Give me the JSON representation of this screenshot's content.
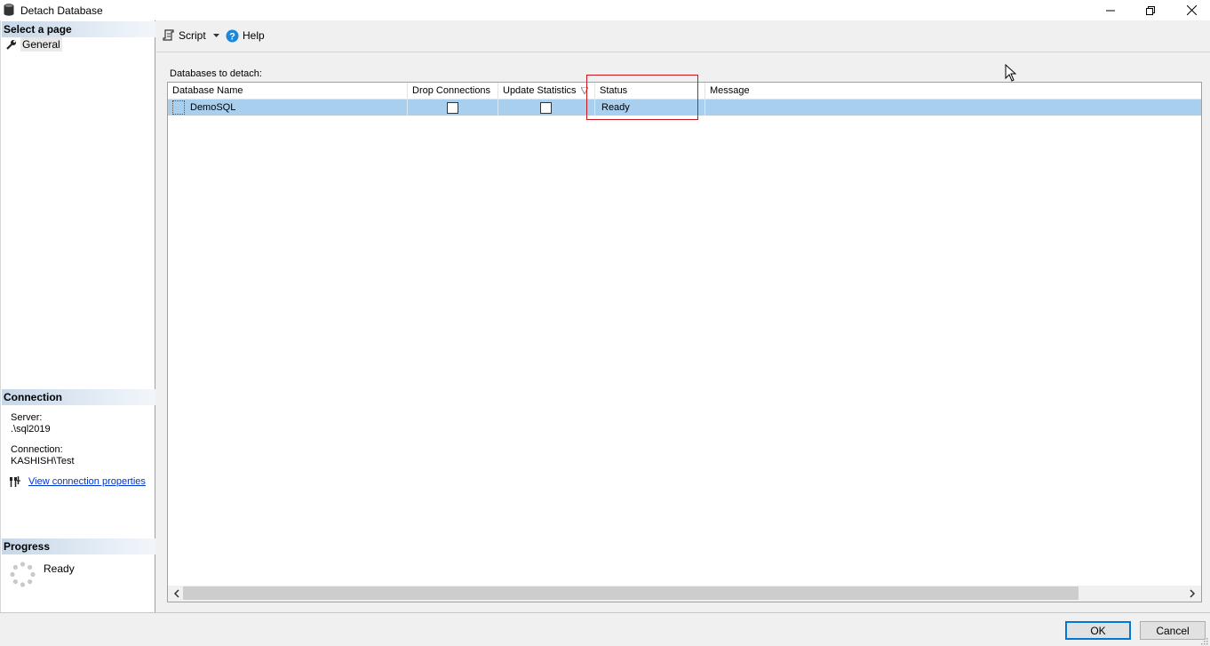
{
  "window": {
    "title": "Detach Database",
    "minimize_label": "minimize",
    "restore_label": "restore",
    "close_label": "close"
  },
  "left_panel": {
    "select_page_header": "Select a page",
    "pages": [
      {
        "label": "General",
        "icon": "wrench-icon"
      }
    ],
    "connection_header": "Connection",
    "server_label": "Server:",
    "server_value": ".\\sql2019",
    "connection_label": "Connection:",
    "connection_value": "KASHISH\\Test",
    "view_connection_link": "View connection properties",
    "progress_header": "Progress",
    "progress_status": "Ready"
  },
  "toolbar": {
    "script_label": "Script",
    "help_label": "Help"
  },
  "main": {
    "databases_label": "Databases to detach:",
    "columns": [
      "Database Name",
      "Drop Connections",
      "Update Statistics",
      "Status",
      "Message"
    ],
    "rows": [
      {
        "database_name": "DemoSQL",
        "drop_connections": false,
        "update_statistics": false,
        "status": "Ready",
        "message": ""
      }
    ]
  },
  "buttons": {
    "ok": "OK",
    "cancel": "Cancel"
  },
  "colors": {
    "row_selected": "#a9cfef",
    "highlight_box": "#c8161d",
    "link": "#0033cc",
    "default_button_border": "#0078d7"
  }
}
